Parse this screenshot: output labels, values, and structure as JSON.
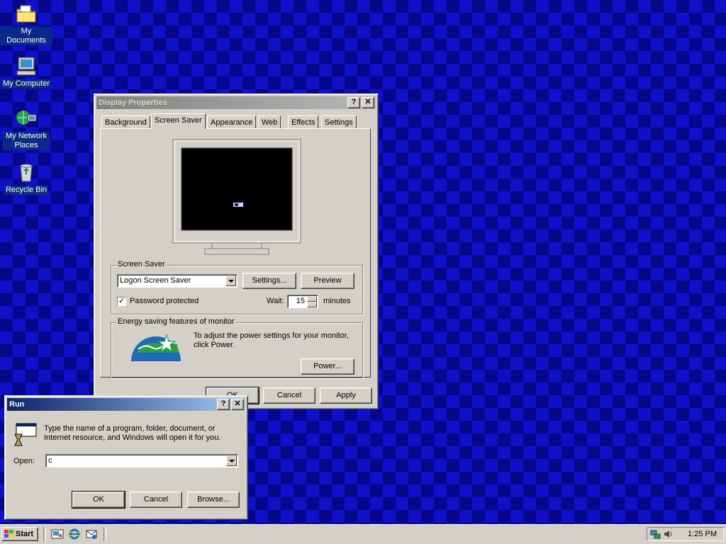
{
  "desktop": {
    "icons": [
      {
        "label": "My Documents"
      },
      {
        "label": "My Computer"
      },
      {
        "label": "My Network Places"
      },
      {
        "label": "Recycle Bin"
      }
    ]
  },
  "display_properties": {
    "title": "Display Properties",
    "help_glyph": "?",
    "close_glyph": "✕",
    "tabs": [
      "Background",
      "Screen Saver",
      "Appearance",
      "Web",
      "Effects",
      "Settings"
    ],
    "selected_tab": "Screen Saver",
    "screen_saver": {
      "group_title": "Screen Saver",
      "selected": "Logon Screen Saver",
      "settings_label": "Settings...",
      "preview_label": "Preview",
      "password_label": "Password protected",
      "password_checked": true,
      "wait_label": "Wait:",
      "wait_value": "15",
      "minutes_label": "minutes"
    },
    "energy": {
      "group_title": "Energy saving features of monitor",
      "text": "To adjust the power settings for your monitor, click Power.",
      "power_label": "Power..."
    },
    "buttons": {
      "ok": "OK",
      "cancel": "Cancel",
      "apply": "Apply"
    }
  },
  "run_dialog": {
    "title": "Run",
    "help_glyph": "?",
    "close_glyph": "✕",
    "description": "Type the name of a program, folder, document, or Internet resource, and Windows will open it for you.",
    "open_label": "Open:",
    "open_value": "c",
    "ok_label": "OK",
    "cancel_label": "Cancel",
    "browse_label": "Browse..."
  },
  "taskbar": {
    "start_label": "Start",
    "clock": "1:25 PM"
  },
  "colors": {
    "desktop": "#1010c8",
    "window_face": "#d4d0c8",
    "active_title": "#0a246a",
    "inactive_title": "#808080"
  }
}
